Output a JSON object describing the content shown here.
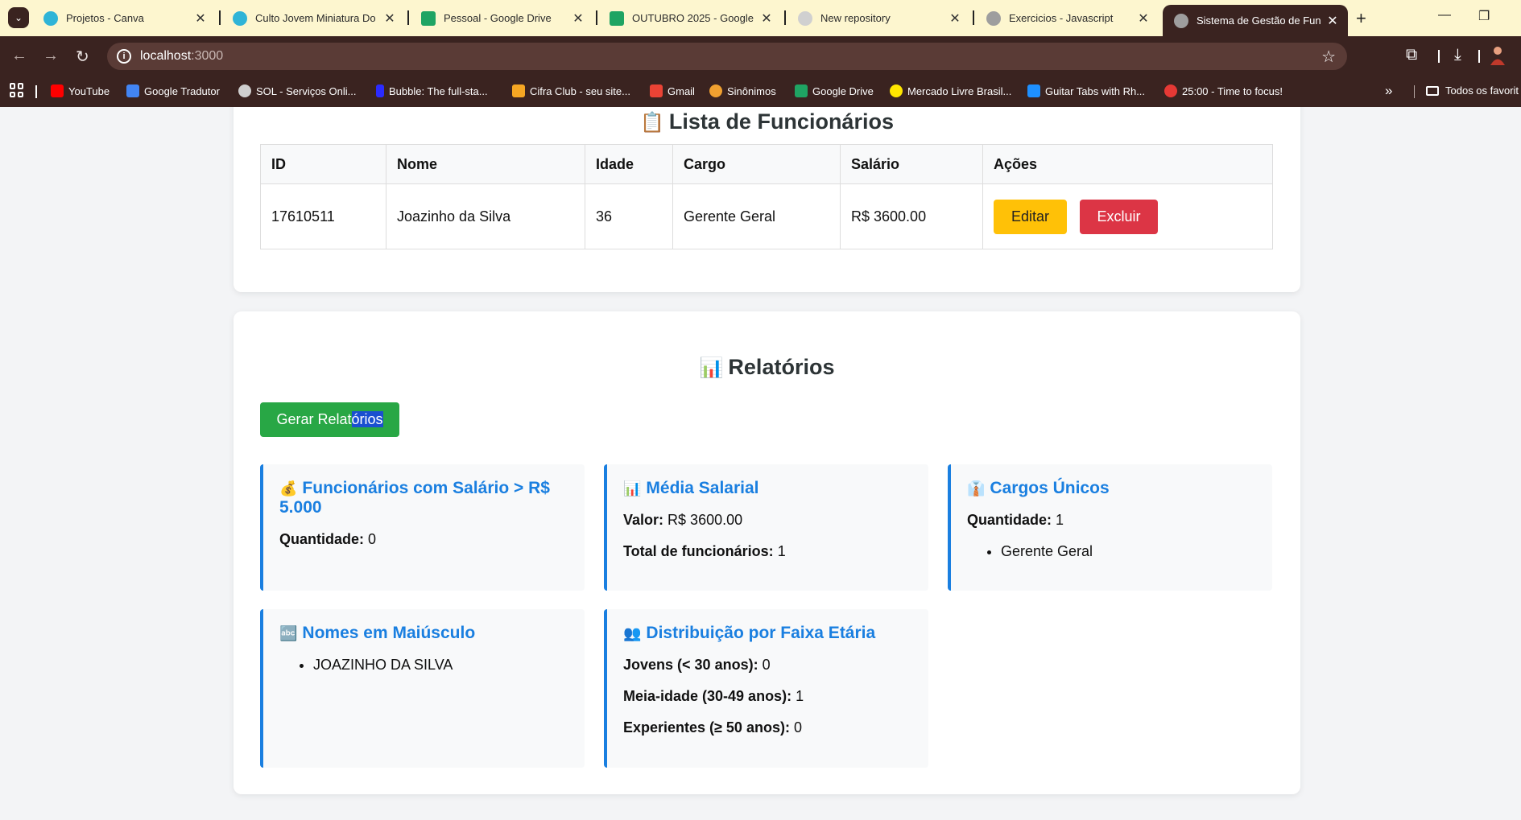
{
  "browser": {
    "tabs": [
      {
        "title": "Projetos - Canva",
        "favicon_color": "#2fb4d7",
        "active": false
      },
      {
        "title": "Culto Jovem Miniatura Do",
        "favicon_color": "#2fb4d7",
        "active": false
      },
      {
        "title": "Pessoal - Google Drive",
        "favicon_color": "#1fa463",
        "active": false
      },
      {
        "title": "OUTUBRO 2025 - Google",
        "favicon_color": "#1fa463",
        "active": false
      },
      {
        "title": "New repository",
        "favicon_color": "#d0d0d0",
        "active": false
      },
      {
        "title": "Exercicios - Javascript",
        "favicon_color": "#9e9e9e",
        "active": false
      },
      {
        "title": "Sistema de Gestão de Fun",
        "favicon_color": "#9e9e9e",
        "active": true
      }
    ],
    "url_host": "localhost",
    "url_port": ":3000",
    "bookmarks": [
      {
        "label": "YouTube",
        "icon_color": "#ff0000"
      },
      {
        "label": "Google Tradutor",
        "icon_color": "#4285f4"
      },
      {
        "label": "SOL - Serviços Onli...",
        "icon_color": "#cfcfcf"
      },
      {
        "label": "Bubble: The full-sta...",
        "icon_color": "#2b2bff"
      },
      {
        "label": "Cifra Club - seu site...",
        "icon_color": "#f5a623"
      },
      {
        "label": "Gmail",
        "icon_color": "#ea4335"
      },
      {
        "label": "Sinônimos",
        "icon_color": "#f0a030"
      },
      {
        "label": "Google Drive",
        "icon_color": "#1fa463"
      },
      {
        "label": "Mercado Livre Brasil...",
        "icon_color": "#ffe600"
      },
      {
        "label": "Guitar Tabs with Rh...",
        "icon_color": "#1e90ff"
      },
      {
        "label": "25:00 - Time to focus!",
        "icon_color": "#e53935"
      }
    ],
    "all_bookmarks": "Todos os favorit"
  },
  "list": {
    "title": "Lista de Funcionários",
    "headers": [
      "ID",
      "Nome",
      "Idade",
      "Cargo",
      "Salário",
      "Ações"
    ],
    "rows": [
      {
        "id": "17610511",
        "nome": "Joazinho da Silva",
        "idade": "36",
        "cargo": "Gerente Geral",
        "salario": "R$ 3600.00"
      }
    ],
    "edit_label": "Editar",
    "delete_label": "Excluir"
  },
  "reports": {
    "title": "Relatórios",
    "generate_prefix": "Gerar Relat",
    "generate_selected": "órios",
    "salary_over": {
      "title": "Funcionários com Salário > R$ 5.000",
      "qty_label": "Quantidade:",
      "qty_value": "0"
    },
    "avg_salary": {
      "title": "Média Salarial",
      "value_label": "Valor:",
      "value": "R$ 3600.00",
      "total_label": "Total de funcionários:",
      "total": "1"
    },
    "unique_roles": {
      "title": "Cargos Únicos",
      "qty_label": "Quantidade:",
      "qty_value": "1",
      "items": [
        "Gerente Geral"
      ]
    },
    "uppercase_names": {
      "title": "Nomes em Maiúsculo",
      "items": [
        "JOAZINHO DA SILVA"
      ]
    },
    "age_distribution": {
      "title": "Distribuição por Faixa Etária",
      "young_label": "Jovens (< 30 anos):",
      "young": "0",
      "middle_label": "Meia-idade (30-49 anos):",
      "middle": "1",
      "senior_label": "Experientes (≥ 50 anos):",
      "senior": "0"
    }
  }
}
